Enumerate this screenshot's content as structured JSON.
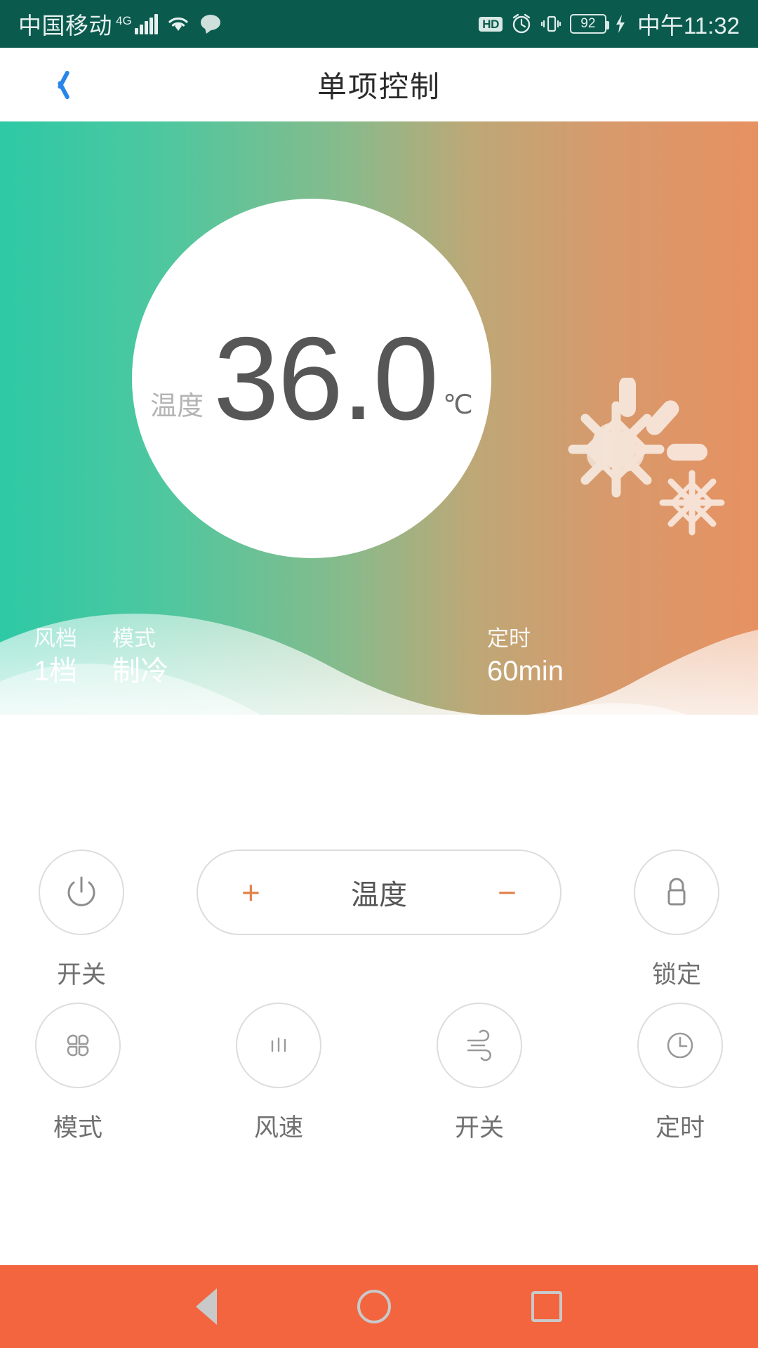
{
  "status_bar": {
    "carrier": "中国移动",
    "network": "4G",
    "signal_icon": "signal-bars-icon",
    "wifi_icon": "wifi-icon",
    "message_icon": "message-bubble-icon",
    "hd_badge": "HD",
    "alarm_icon": "alarm-clock-icon",
    "vibrate_icon": "vibrate-icon",
    "battery_level": "92",
    "charging_icon": "charging-bolt-icon",
    "time": "中午11:32"
  },
  "title_bar": {
    "back_icon": "back-chevron-icon",
    "title": "单项控制"
  },
  "hero": {
    "gradient_start": "#2ec9a6",
    "gradient_end": "#e79161",
    "decoration_icon": "snowflake-decoration-icon",
    "dial": {
      "label": "温度",
      "value": "36.0",
      "unit": "℃"
    },
    "info": [
      {
        "key": "风档",
        "value": "1档"
      },
      {
        "key": "模式",
        "value": "制冷"
      },
      {
        "key": "定时",
        "value": "60min"
      }
    ]
  },
  "controls": {
    "power": {
      "label": "开关",
      "icon": "power-icon"
    },
    "temperature": {
      "increase": "+",
      "label": "温度",
      "decrease": "−",
      "accent": "#e2854c"
    },
    "lock": {
      "label": "锁定",
      "icon": "lock-icon"
    },
    "row2": [
      {
        "label": "模式",
        "icon": "mode-grid-icon"
      },
      {
        "label": "风速",
        "icon": "fan-speed-bars-icon"
      },
      {
        "label": "开关",
        "icon": "swing-wind-icon"
      },
      {
        "label": "定时",
        "icon": "clock-icon"
      }
    ]
  },
  "nav_bar": {
    "background": "#f2653f",
    "back": "nav-back-icon",
    "home": "nav-home-icon",
    "recents": "nav-recents-icon"
  }
}
